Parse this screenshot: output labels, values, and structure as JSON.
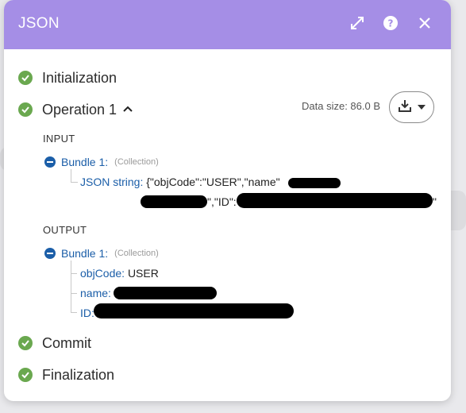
{
  "window": {
    "title": "JSON"
  },
  "icons": {
    "expand": "expand-arrows-icon",
    "help": "question-circle-icon",
    "close": "close-x-icon",
    "step_done": "check-circle-icon",
    "download": "download-icon",
    "collapse_bundle": "minus-circle-icon"
  },
  "colors": {
    "header": "#a58ee6",
    "success": "#6aa84f",
    "link": "#1b5ea8"
  },
  "steps": {
    "initialization": "Initialization",
    "operation": "Operation 1",
    "commit": "Commit",
    "finalization": "Finalization"
  },
  "operation": {
    "data_size": "Data size: 86.0 B"
  },
  "input": {
    "label": "INPUT",
    "bundle": "Bundle 1:",
    "bundle_type": "(Collection)",
    "json_key": "JSON string:",
    "json_value_start": "{\"objCode\":\"USER\",\"name\"",
    "json_value_mid": "\",\"ID\":",
    "json_value_end": "\""
  },
  "output": {
    "label": "OUTPUT",
    "bundle": "Bundle 1:",
    "bundle_type": "(Collection)",
    "fields": [
      {
        "key": "objCode:",
        "value": "USER"
      },
      {
        "key": "name:",
        "value": ""
      },
      {
        "key": "ID:",
        "value": ""
      }
    ]
  }
}
